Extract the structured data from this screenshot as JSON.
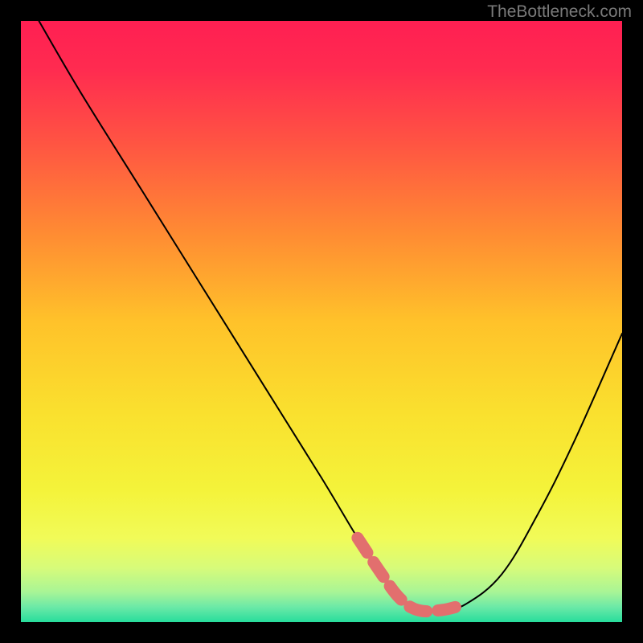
{
  "watermark": "TheBottleneck.com",
  "chart_data": {
    "type": "line",
    "title": "",
    "xlabel": "",
    "ylabel": "",
    "xlim": [
      0,
      100
    ],
    "ylim": [
      0,
      100
    ],
    "series": [
      {
        "name": "bottleneck-curve",
        "x": [
          3,
          10,
          20,
          30,
          40,
          50,
          56,
          60,
          63,
          66,
          70,
          74,
          80,
          86,
          92,
          100
        ],
        "y": [
          100,
          88,
          72,
          56,
          40,
          24,
          14,
          8,
          4,
          2,
          2,
          3,
          8,
          18,
          30,
          48
        ]
      }
    ],
    "highlight_segment": {
      "name": "flat-bottom-highlight",
      "x": [
        56,
        60,
        63,
        66,
        70,
        74
      ],
      "y": [
        14,
        8,
        4,
        2,
        2,
        3
      ]
    },
    "background_gradient_stops": [
      {
        "offset": 0.0,
        "color": "#ff1f52"
      },
      {
        "offset": 0.08,
        "color": "#ff2b50"
      },
      {
        "offset": 0.2,
        "color": "#ff5343"
      },
      {
        "offset": 0.35,
        "color": "#ff8a33"
      },
      {
        "offset": 0.5,
        "color": "#ffc22a"
      },
      {
        "offset": 0.65,
        "color": "#fae02e"
      },
      {
        "offset": 0.78,
        "color": "#f4f33a"
      },
      {
        "offset": 0.86,
        "color": "#f1fb58"
      },
      {
        "offset": 0.91,
        "color": "#d7fb7a"
      },
      {
        "offset": 0.95,
        "color": "#a8f596"
      },
      {
        "offset": 0.975,
        "color": "#6be9a7"
      },
      {
        "offset": 1.0,
        "color": "#27dd9c"
      }
    ]
  }
}
